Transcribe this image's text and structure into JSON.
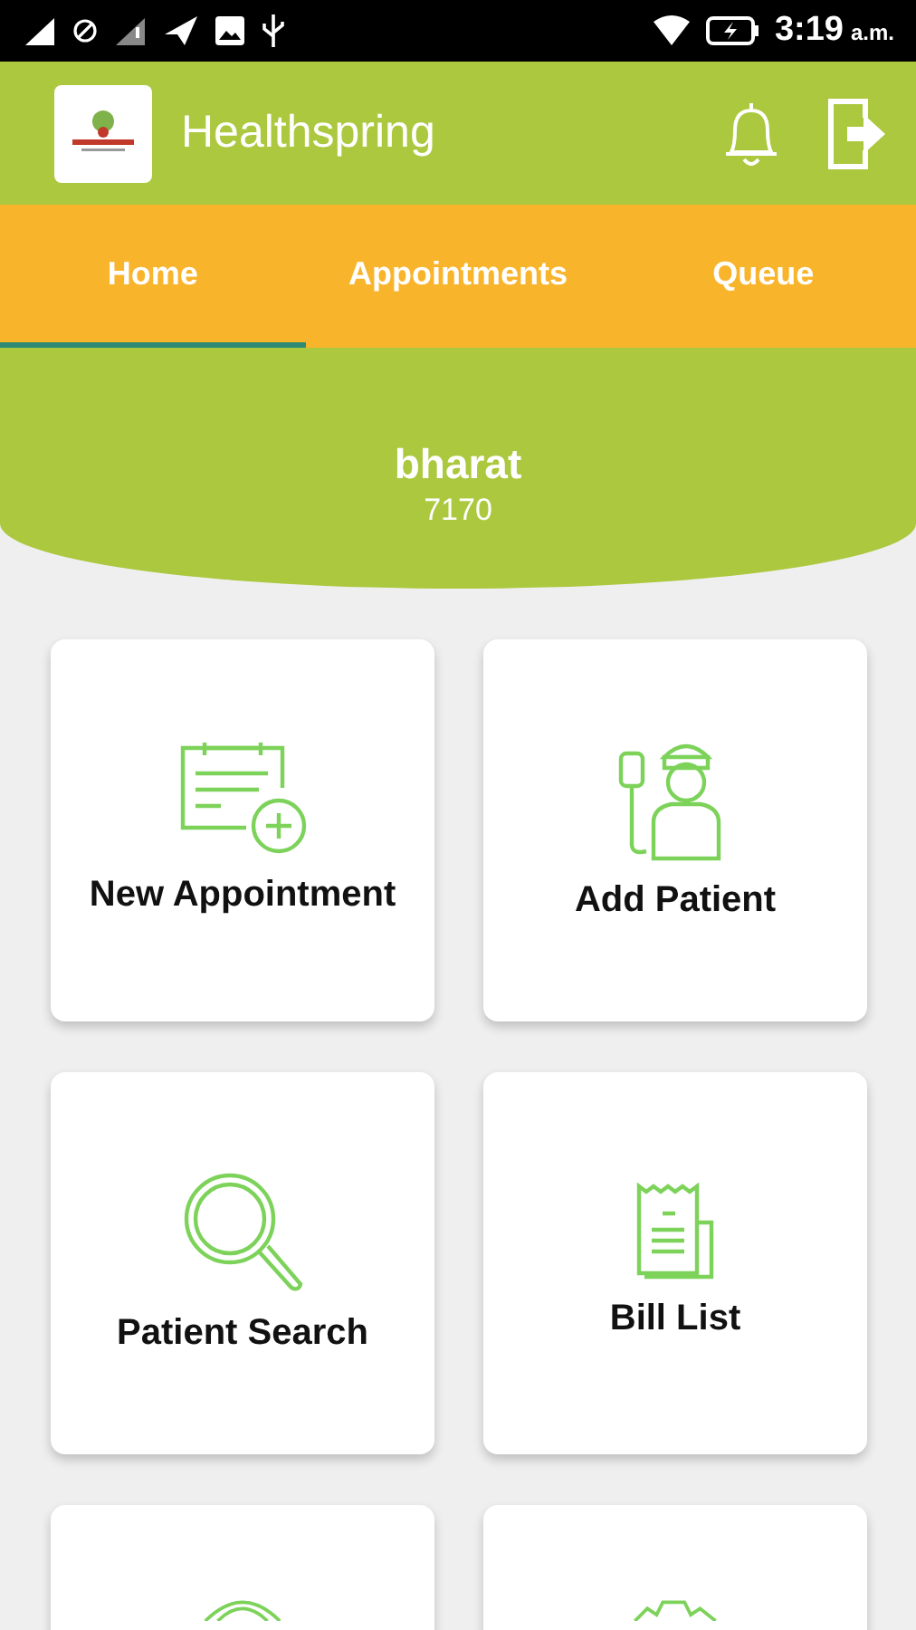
{
  "status_bar": {
    "time": "3:19",
    "period": "a.m."
  },
  "app_bar": {
    "title": "Healthspring"
  },
  "tabs": [
    {
      "label": "Home",
      "selected": true
    },
    {
      "label": "Appointments",
      "selected": false
    },
    {
      "label": "Queue",
      "selected": false
    }
  ],
  "profile": {
    "name": "bharat",
    "id": "7170"
  },
  "tiles": [
    {
      "kind": "appointment",
      "label": "New Appointment"
    },
    {
      "kind": "patient",
      "label": "Add Patient"
    },
    {
      "kind": "search",
      "label": "Patient Search"
    },
    {
      "kind": "bill",
      "label": "Bill List"
    },
    {
      "kind": "target"
    },
    {
      "kind": "gear"
    }
  ]
}
